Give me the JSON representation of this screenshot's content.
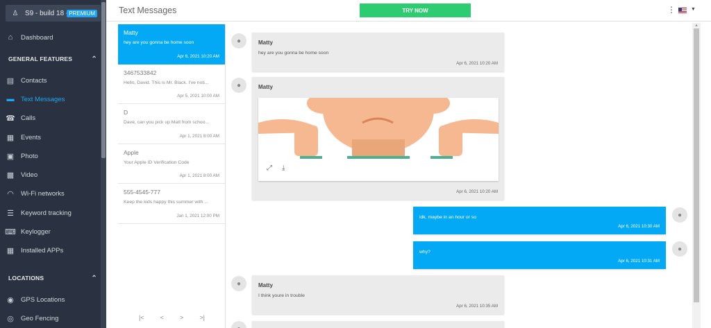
{
  "device": {
    "name": "S9 - build 18 - ",
    "badge": "PREMIUM",
    "icon": "android-icon"
  },
  "sidebar": {
    "dashboard": {
      "label": "Dashboard",
      "icon": "home-icon"
    },
    "general_section": "GENERAL FEATURES",
    "general_items": [
      {
        "label": "Contacts",
        "icon": "contacts-icon"
      },
      {
        "label": "Text Messages",
        "icon": "chat-icon",
        "active": true
      },
      {
        "label": "Calls",
        "icon": "phone-icon"
      },
      {
        "label": "Events",
        "icon": "calendar-icon"
      },
      {
        "label": "Photo",
        "icon": "image-icon"
      },
      {
        "label": "Video",
        "icon": "video-icon"
      },
      {
        "label": "Wi-Fi networks",
        "icon": "wifi-icon"
      },
      {
        "label": "Keyword tracking",
        "icon": "keyword-icon"
      },
      {
        "label": "Keylogger",
        "icon": "keyboard-icon"
      },
      {
        "label": "Installed APPs",
        "icon": "apps-grid-icon"
      }
    ],
    "locations_section": "LOCATIONS",
    "location_items": [
      {
        "label": "GPS Locations",
        "icon": "location-pin-icon"
      },
      {
        "label": "Geo Fencing",
        "icon": "geofence-icon"
      }
    ]
  },
  "header": {
    "title": "Text Messages",
    "try_label": "TRY NOW"
  },
  "conversations": [
    {
      "name": "Matty",
      "preview": "hey are you gonna be home soon",
      "date": "Apr 6, 2021 10:20 AM",
      "active": true
    },
    {
      "name": "3467533842",
      "preview": "Hello, David. This is Mr. Black. I've noti...",
      "date": "Apr 5, 2021 10:00 AM"
    },
    {
      "name": "D",
      "preview": "Dave, can you pick up Matt from schoo...",
      "date": "Apr 1, 2021 8:00 AM"
    },
    {
      "name": "Apple",
      "preview": "Your Apple ID Verification Code",
      "date": "Apr 1, 2021 8:00 AM"
    },
    {
      "name": "555-4545-777",
      "preview": "Keep the kids happy this summer with ...",
      "date": "Jan 1, 2021 12:00 PM"
    }
  ],
  "pager": {
    "first": "|<",
    "prev": "<",
    "next": ">",
    "last": ">|"
  },
  "messages": [
    {
      "sender": "Matty",
      "text": "hey are you gonna be home soon",
      "time": "Apr 6, 2021 10:20 AM",
      "direction": "in"
    },
    {
      "sender": "Matty",
      "type": "image",
      "time": "Apr 6, 2021 10:20 AM",
      "direction": "in"
    },
    {
      "text": "idk, maybe in an hour or so",
      "time": "Apr 6, 2021 10:30 AM",
      "direction": "out"
    },
    {
      "text": "why?",
      "time": "Apr 6, 2021 10:31 AM",
      "direction": "out"
    },
    {
      "sender": "Matty",
      "text": "I think youre in trouble",
      "time": "Apr 6, 2021 10:35 AM",
      "direction": "in"
    }
  ],
  "colors": {
    "accent": "#03a9f4",
    "sidebar_bg": "#2a3241",
    "try_button": "#2ecc71",
    "active_nav": "#1ea7f0"
  }
}
